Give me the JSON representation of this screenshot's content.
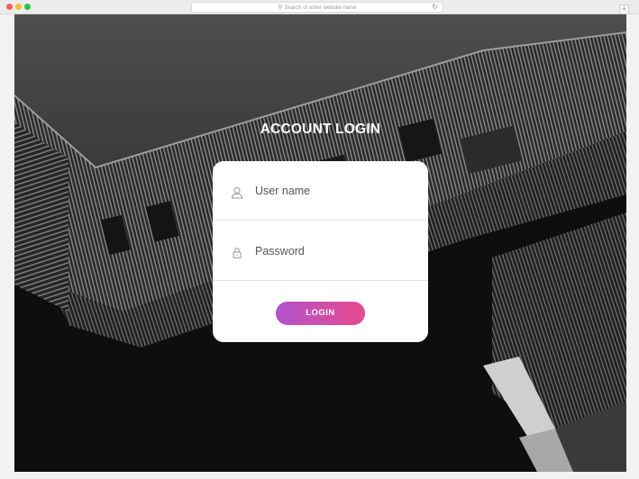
{
  "browser": {
    "address_placeholder": "Search or enter website name",
    "new_tab_label": "+"
  },
  "page": {
    "title": "ACCOUNT LOGIN",
    "username_placeholder": "User name",
    "password_placeholder": "Password",
    "login_label": "LOGIN"
  },
  "colors": {
    "button_gradient_start": "#b153cc",
    "button_gradient_end": "#e84a8e",
    "card_background": "#ffffff"
  },
  "icons": [
    "user-icon",
    "lock-icon",
    "search-icon",
    "reload-icon"
  ]
}
